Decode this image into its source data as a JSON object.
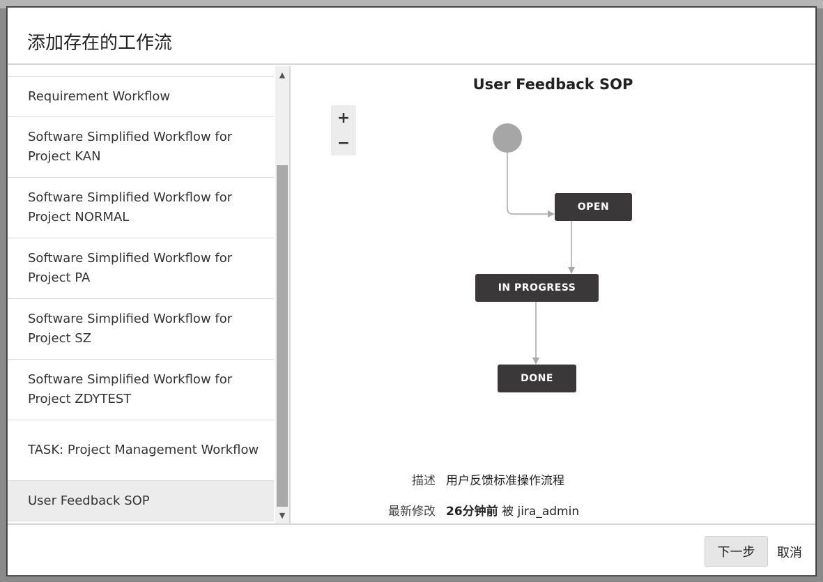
{
  "dialog": {
    "title": "添加存在的工作流"
  },
  "workflow_list": {
    "items": [
      {
        "label": "Requirement Workflow"
      },
      {
        "label": "Software Simplified Workflow for Project KAN"
      },
      {
        "label": "Software Simplified Workflow for Project NORMAL"
      },
      {
        "label": "Software Simplified Workflow for Project PA"
      },
      {
        "label": "Software Simplified Workflow for Project SZ"
      },
      {
        "label": "Software Simplified Workflow for Project ZDYTEST"
      },
      {
        "label": "TASK: Project Management Workflow"
      },
      {
        "label": "User Feedback SOP"
      }
    ],
    "selected": "User Feedback SOP"
  },
  "preview": {
    "title": "User Feedback SOP",
    "zoom_in": "+",
    "zoom_out": "−",
    "statuses": {
      "open": "OPEN",
      "in_progress": "IN PROGRESS",
      "done": "DONE"
    },
    "description_label": "描述",
    "description_value": "用户反馈标准操作流程",
    "modified_label": "最新修改",
    "modified_time": "26分钟前",
    "modified_by_word": "被",
    "modified_user": "jira_admin"
  },
  "footer": {
    "next_label": "下一步",
    "cancel_label": "取消"
  },
  "colors": {
    "status_box": "#3a3838",
    "connector": "#a9a9a9",
    "initial_node": "#a6a6a6"
  }
}
